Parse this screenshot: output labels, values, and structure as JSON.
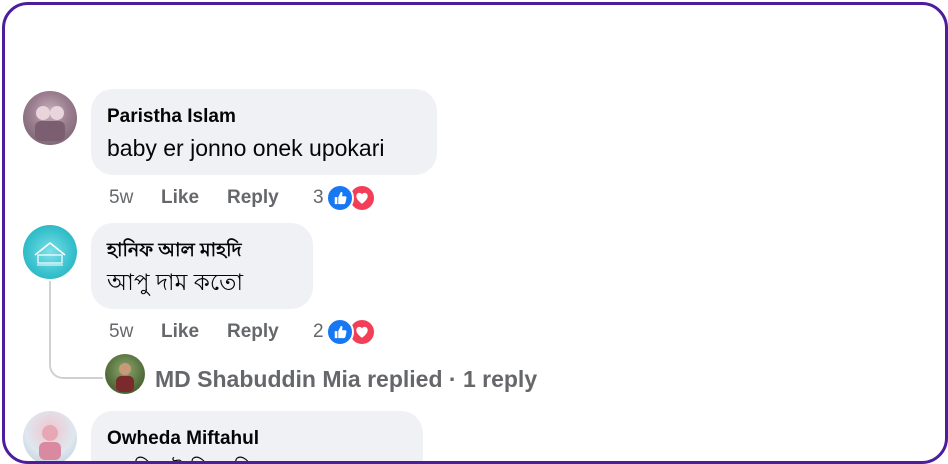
{
  "comments": [
    {
      "author": "Paristha Islam",
      "text": "baby er jonno onek upokari",
      "time": "5w",
      "like_label": "Like",
      "reply_label": "Reply",
      "reaction_count": "3"
    },
    {
      "author": "হানিফ আল মাহদি",
      "text": "আপু দাম কতো",
      "time": "5w",
      "like_label": "Like",
      "reply_label": "Reply",
      "reaction_count": "2",
      "replies_summary": "MD Shabuddin Mia replied · 1 reply"
    },
    {
      "author": "Owheda Miftahul",
      "text": "আমি দুই পিস নিবো দাম কত"
    }
  ],
  "colors": {
    "frame": "#4b1e9e",
    "like_blue": "#1877f2",
    "love_red": "#f33e58",
    "bubble_bg": "#eff1f5",
    "meta_gray": "#65676b"
  }
}
